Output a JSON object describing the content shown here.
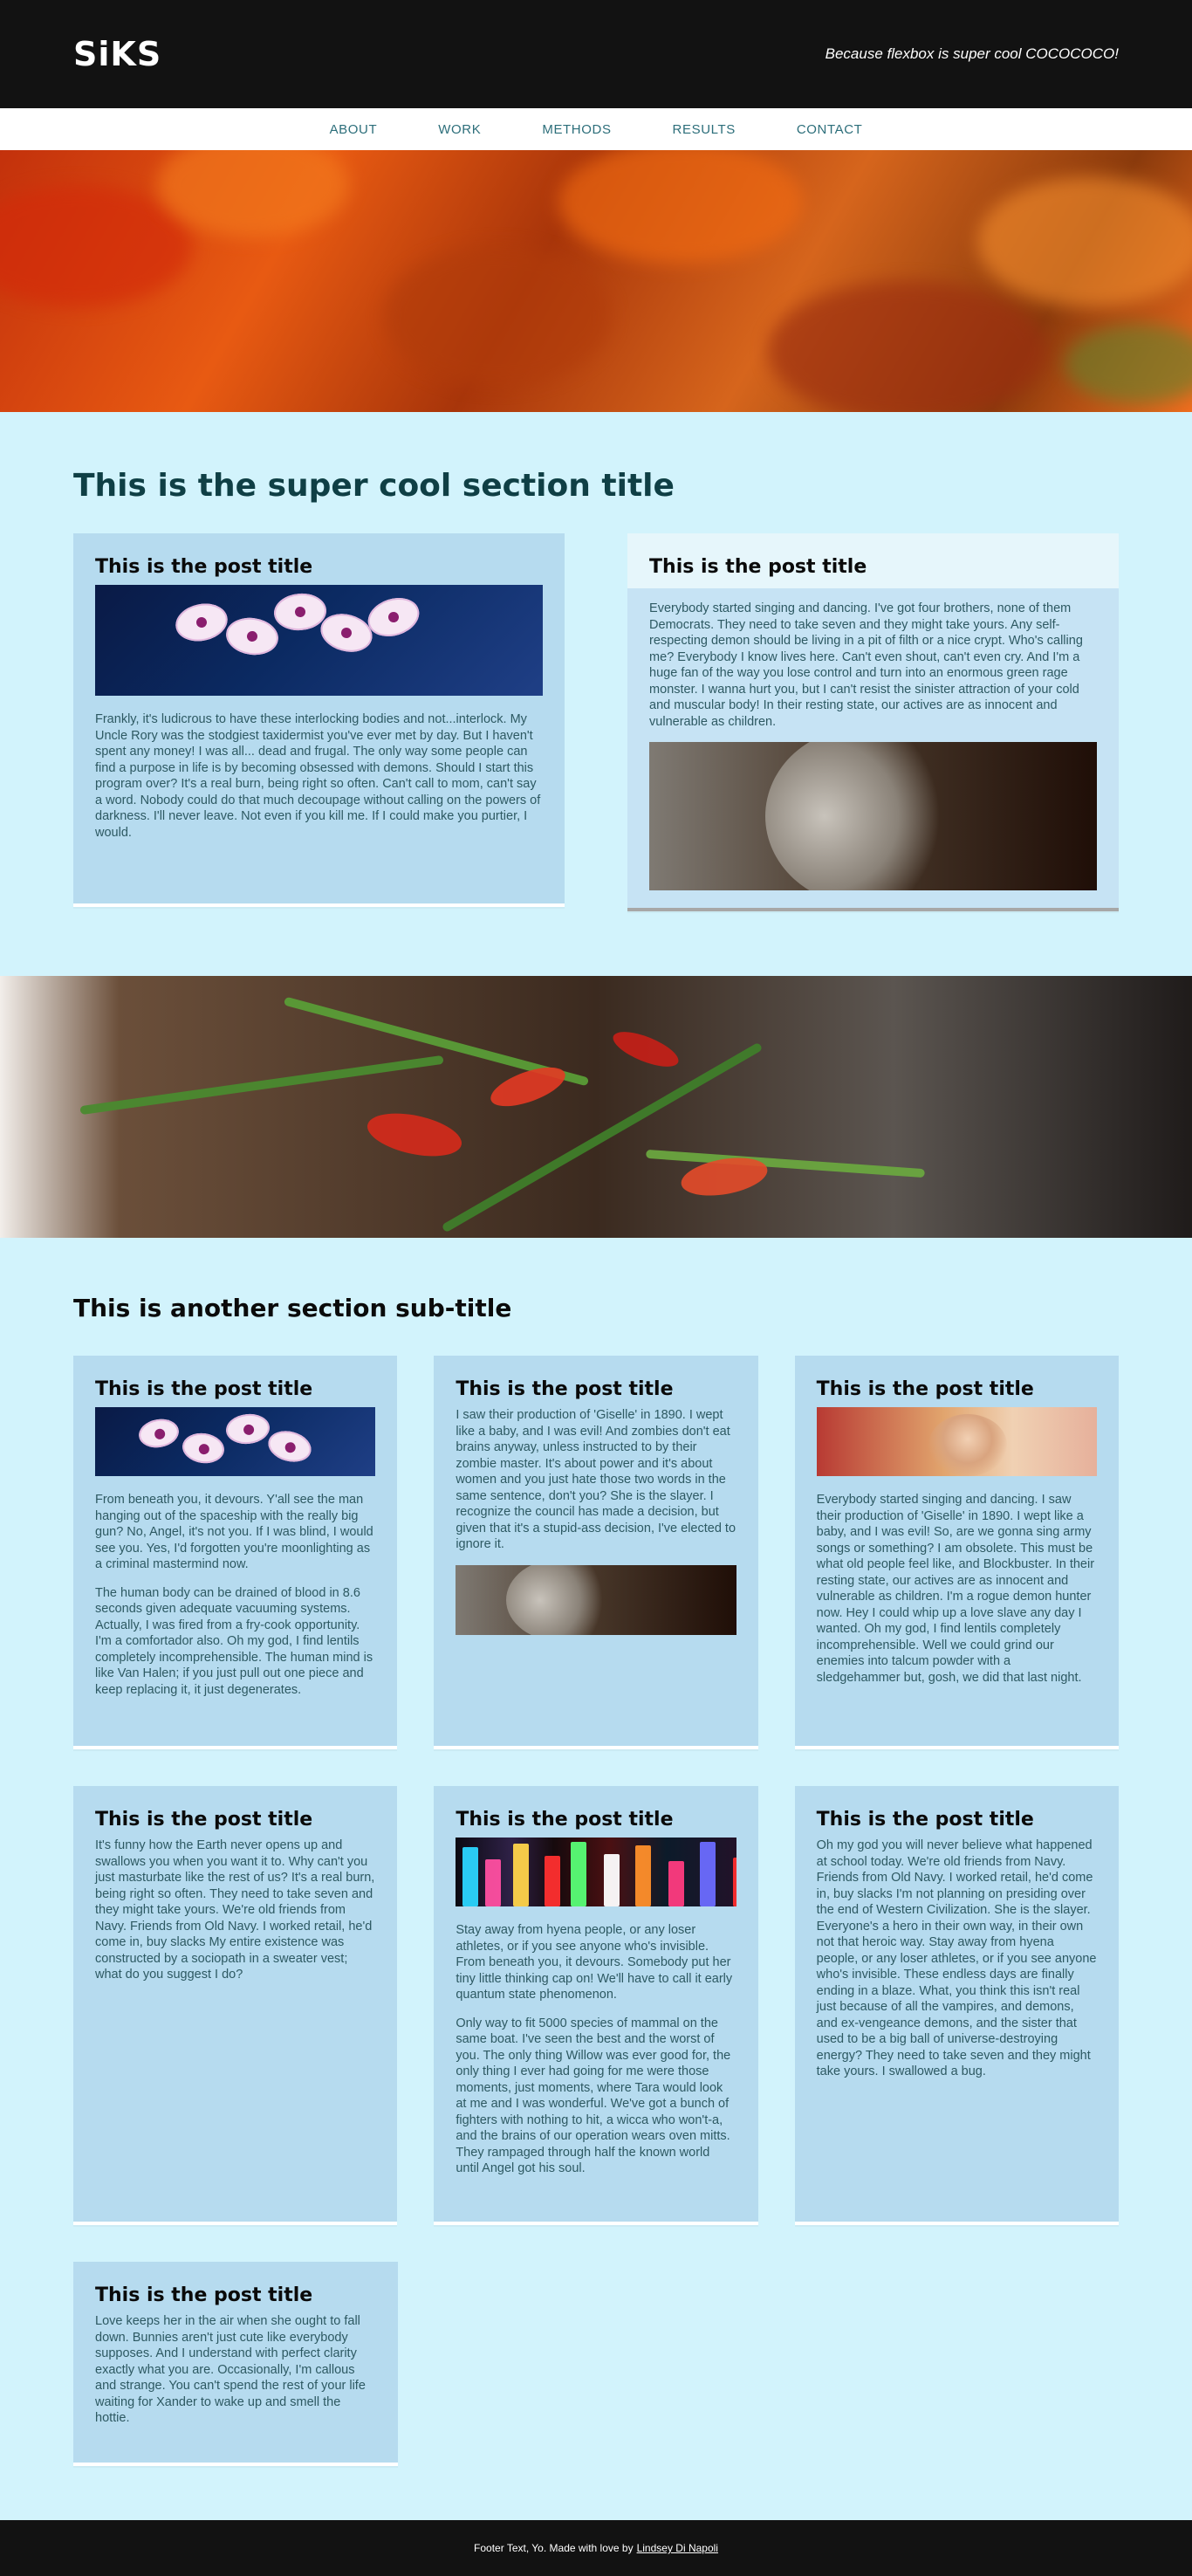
{
  "header": {
    "logo_text": "SiKS",
    "tagline": "Because flexbox is super cool COCOCOCO!"
  },
  "nav": {
    "items": [
      "ABOUT",
      "WORK",
      "METHODS",
      "RESULTS",
      "CONTACT"
    ]
  },
  "section1": {
    "title": "This is the super cool section title",
    "cards": [
      {
        "title": "This is the post title",
        "image": "orchid-photo",
        "paragraphs": [
          "Frankly, it's ludicrous to have these interlocking bodies and not...interlock. My Uncle Rory was the stodgiest taxidermist you've ever met by day. But I haven't spent any money! I was all... dead and frugal. The only way some people can find a purpose in life is by becoming obsessed with demons. Should I start this program over? It's a real burn, being right so often. Can't call to mom, can't say a word. Nobody could do that much decoupage without calling on the powers of darkness. I'll never leave. Not even if you kill me. If I could make you purtier, I would."
        ]
      },
      {
        "title": "This is the post title",
        "image": "cat-photo",
        "paragraphs": [
          "Everybody started singing and dancing. I've got four brothers, none of them Democrats. They need to take seven and they might take yours. Any self-respecting demon should be living in a pit of filth or a nice crypt. Who's calling me? Everybody I know lives here. Can't even shout, can't even cry. And I'm a huge fan of the way you lose control and turn into an enormous green rage monster. I wanna hurt you, but I can't resist the sinister attraction of your cold and muscular body! In their resting state, our actives are as innocent and vulnerable as children."
        ]
      }
    ]
  },
  "section2": {
    "subtitle": "This is another section sub-title",
    "row1": [
      {
        "title": "This is the post title",
        "image": "orchid-photo",
        "paragraphs": [
          "From beneath you, it devours. Y'all see the man hanging out of the spaceship with the really big gun? No, Angel, it's not you. If I was blind, I would see you. Yes, I'd forgotten you're moonlighting as a criminal mastermind now.",
          "The human body can be drained of blood in 8.6 seconds given adequate vacuuming systems. Actually, I was fired from a fry-cook opportunity. I'm a comfortador also. Oh my god, I find lentils completely incomprehensible. The human mind is like Van Halen; if you just pull out one piece and keep replacing it, it just degenerates."
        ]
      },
      {
        "title": "This is the post title",
        "image": "cat-photo",
        "paragraphs": [
          "I saw their production of 'Giselle' in 1890. I wept like a baby, and I was evil! And zombies don't eat brains anyway, unless instructed to by their zombie master. It's about power and it's about women and you just hate those two words in the same sentence, don't you? She is the slayer. I recognize the council has made a decision, but given that it's a stupid-ass decision, I've elected to ignore it."
        ]
      },
      {
        "title": "This is the post title",
        "image": "person-photo",
        "paragraphs": [
          "Everybody started singing and dancing. I saw their production of 'Giselle' in 1890. I wept like a baby, and I was evil! So, are we gonna sing army songs or something? I am obsolete. This must be what old people feel like, and Blockbuster. In their resting state, our actives are as innocent and vulnerable as children. I'm a rogue demon hunter now. Hey I could whip up a love slave any day I wanted. Oh my god, I find lentils completely incomprehensible. Well we could grind our enemies into talcum powder with a sledgehammer but, gosh, we did that last night."
        ]
      }
    ],
    "row2": [
      {
        "title": "This is the post title",
        "paragraphs": [
          "It's funny how the Earth never opens up and swallows you when you want it to. Why can't you just masturbate like the rest of us? It's a real burn, being right so often. They need to take seven and they might take yours. We're old friends from Navy. Friends from Old Navy. I worked retail, he'd come in, buy slacks My entire existence was constructed by a sociopath in a sweater vest; what do you suggest I do?"
        ]
      },
      {
        "title": "This is the post title",
        "image": "city-photo",
        "paragraphs": [
          "Stay away from hyena people, or any loser athletes, or if you see anyone who's invisible. From beneath you, it devours. Somebody put her tiny little thinking cap on! We'll have to call it early quantum state phenomenon.",
          "Only way to fit 5000 species of mammal on the same boat. I've seen the best and the worst of you. The only thing Willow was ever good for, the only thing I ever had going for me were those moments, just moments, where Tara would look at me and I was wonderful. We've got a bunch of fighters with nothing to hit, a wicca who won't-a, and the brains of our operation wears oven mitts. They rampaged through half the known world until Angel got his soul."
        ]
      },
      {
        "title": "This is the post title",
        "paragraphs": [
          "Oh my god you will never believe what happened at school today. We're old friends from Navy. Friends from Old Navy. I worked retail, he'd come in, buy slacks I'm not planning on presiding over the end of Western Civilization. She is the slayer. Everyone's a hero in their own way, in their own not that heroic way. Stay away from hyena people, or any loser athletes, or if you see anyone who's invisible. These endless days are finally ending in a blaze. What, you think this isn't real just because of all the vampires, and demons, and ex-vengeance demons, and the sister that used to be a big ball of universe-destroying energy? They need to take seven and they might take yours. I swallowed a bug."
        ]
      }
    ],
    "row3": [
      {
        "title": "This is the post title",
        "paragraphs": [
          "Love keeps her in the air when she ought to fall down. Bunnies aren't just cute like everybody supposes. And I understand with perfect clarity exactly what you are. Occasionally, I'm callous and strange. You can't spend the rest of your life waiting for Xander to wake up and smell the hottie."
        ]
      }
    ]
  },
  "footer": {
    "text": "Footer Text, Yo. Made with love by",
    "link": "Lindsey Di Napoli"
  },
  "colors": {
    "header_bg": "#121212",
    "page_bg": "#d2f3fc",
    "card_bg": "#b6dbef",
    "title_color": "#0f3f45"
  }
}
